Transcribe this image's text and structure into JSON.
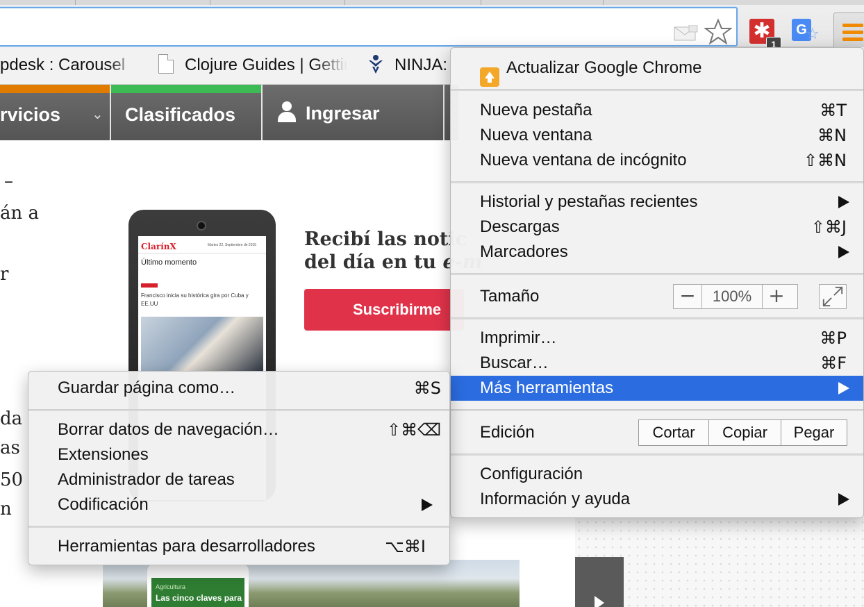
{
  "toolbar": {
    "extension_badge": "1",
    "translate_letter": "G"
  },
  "bookmarks": [
    {
      "label": "pdesk : Carousel"
    },
    {
      "label": "Clojure Guides | Getting"
    },
    {
      "label": "NINJA:"
    }
  ],
  "site_nav": {
    "servicios": "rvicios",
    "clasificados": "Clasificados",
    "ingresar": "Ingresar",
    "accent_orange": "#e07b00",
    "accent_green": "#3cba54"
  },
  "article": {
    "fragments": [
      "–",
      "án a",
      "r",
      "da",
      "as",
      "50",
      "n"
    ],
    "promo_line1": "Recibí las notic",
    "promo_line2_prefix": "del día en tu ",
    "promo_line2_italic": "e-m",
    "subscribe_label": "Suscribirme",
    "phone_brand": "ClarínX",
    "phone_date": "Martes 22, Septiembre de 2015",
    "phone_section": "Último momento",
    "phone_news": "Francisco inicia su histórica gira por Cuba y EE.UU",
    "banner_category": "Agricultura",
    "banner_headline": "Las cinco claves para"
  },
  "main_menu": {
    "update": "Actualizar Google Chrome",
    "new_tab": {
      "label": "Nueva pestaña",
      "shortcut": "⌘T"
    },
    "new_window": {
      "label": "Nueva ventana",
      "shortcut": "⌘N"
    },
    "incognito": {
      "label": "Nueva ventana de incógnito",
      "shortcut": "⇧⌘N"
    },
    "history": {
      "label": "Historial y pestañas recientes"
    },
    "downloads": {
      "label": "Descargas",
      "shortcut": "⇧⌘J"
    },
    "bookmarks": {
      "label": "Marcadores"
    },
    "zoom": {
      "label": "Tamaño",
      "minus": "−",
      "value": "100%",
      "plus": "+"
    },
    "print": {
      "label": "Imprimir…",
      "shortcut": "⌘P"
    },
    "find": {
      "label": "Buscar…",
      "shortcut": "⌘F"
    },
    "more_tools": {
      "label": "Más herramientas"
    },
    "edit": {
      "label": "Edición",
      "cut": "Cortar",
      "copy": "Copiar",
      "paste": "Pegar"
    },
    "settings": {
      "label": "Configuración"
    },
    "help": {
      "label": "Información y ayuda"
    },
    "highlight_color": "#2b6ce0"
  },
  "sub_menu": {
    "save_page": {
      "label": "Guardar página como…",
      "shortcut": "⌘S"
    },
    "clear_data": {
      "label": "Borrar datos de navegación…",
      "shortcut": "⇧⌘⌫"
    },
    "extensions": {
      "label": "Extensiones"
    },
    "task_manager": {
      "label": "Administrador de tareas"
    },
    "encoding": {
      "label": "Codificación"
    },
    "dev_tools": {
      "label": "Herramientas para desarrolladores",
      "shortcut": "⌥⌘I"
    }
  }
}
